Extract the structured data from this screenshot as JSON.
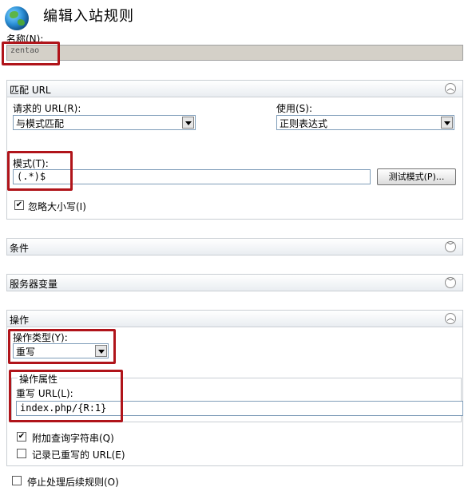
{
  "header": {
    "title": "编辑入站规则",
    "icon": "globe-icon"
  },
  "name": {
    "label": "名称(N):",
    "value": "zentao"
  },
  "match_url": {
    "header": "匹配 URL",
    "requested_url_label": "请求的 URL(R):",
    "requested_url_value": "与模式匹配",
    "using_label": "使用(S):",
    "using_value": "正则表达式",
    "pattern_label": "模式(T):",
    "pattern_value": "(.*)$",
    "test_button": "测试模式(P)...",
    "ignore_case_label": "忽略大小写(I)",
    "ignore_case_checked": true
  },
  "conditions": {
    "header": "条件"
  },
  "server_vars": {
    "header": "服务器变量"
  },
  "action": {
    "header": "操作",
    "type_label": "操作类型(Y):",
    "type_value": "重写",
    "props_label": "操作属性",
    "rewrite_url_label": "重写 URL(L):",
    "rewrite_url_value": "index.php/{R:1}",
    "append_query_label": "附加查询字符串(Q)",
    "append_query_checked": true,
    "log_rewritten_label": "记录已重写的 URL(E)",
    "log_rewritten_checked": false,
    "stop_processing_label": "停止处理后续规则(O)",
    "stop_processing_checked": false
  },
  "colors": {
    "highlight": "#b0141a",
    "section_bg": "#e9edf1"
  }
}
